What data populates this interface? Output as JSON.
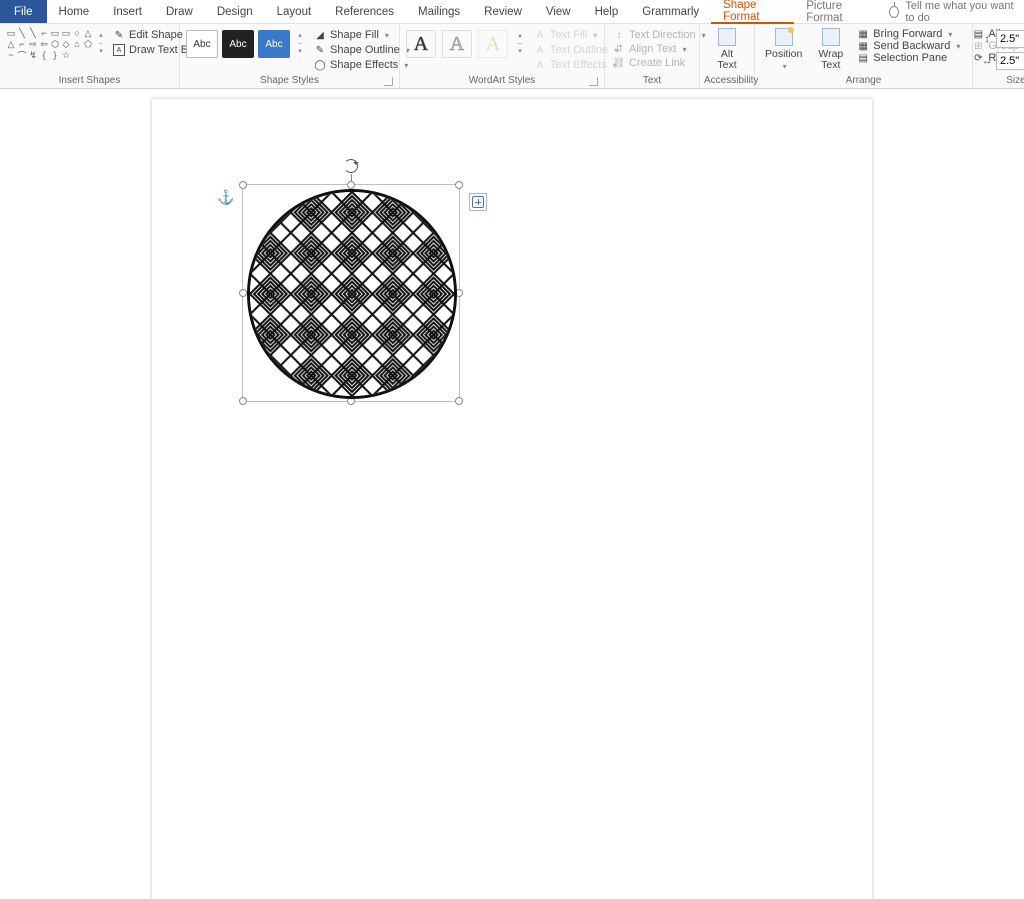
{
  "tabs": {
    "file": "File",
    "home": "Home",
    "insert": "Insert",
    "draw": "Draw",
    "design": "Design",
    "layout": "Layout",
    "references": "References",
    "mailings": "Mailings",
    "review": "Review",
    "view": "View",
    "help": "Help",
    "grammarly": "Grammarly",
    "shape_format": "Shape Format",
    "picture_format": "Picture Format",
    "tellme": "Tell me what you want to do"
  },
  "groups": {
    "insert_shapes": "Insert Shapes",
    "shape_styles": "Shape Styles",
    "wordart_styles": "WordArt Styles",
    "text": "Text",
    "accessibility": "Accessibility",
    "arrange": "Arrange",
    "size": "Size"
  },
  "insert_shapes": {
    "edit_shape": "Edit Shape",
    "draw_text_box": "Draw Text Box"
  },
  "shape_styles": {
    "abc": "Abc",
    "fill": "Shape Fill",
    "outline": "Shape Outline",
    "effects": "Shape Effects"
  },
  "wordart": {
    "text_fill": "Text Fill",
    "text_outline": "Text Outline",
    "text_effects": "Text Effects"
  },
  "text_group": {
    "direction": "Text Direction",
    "align": "Align Text",
    "link": "Create Link"
  },
  "accessibility": {
    "alt": "Alt",
    "text": "Text"
  },
  "arrange": {
    "position": "Position",
    "wrap": "Wrap",
    "wrap2": "Text",
    "bring_forward": "Bring Forward",
    "send_backward": "Send Backward",
    "selection_pane": "Selection Pane",
    "align": "Align",
    "group": "Group",
    "rotate": "Rotate"
  },
  "size": {
    "height": "2.5\"",
    "width": "2.5\""
  },
  "icons": {
    "dropdown": "▾",
    "up": "▴",
    "down": "▾",
    "launcher": "↘"
  }
}
